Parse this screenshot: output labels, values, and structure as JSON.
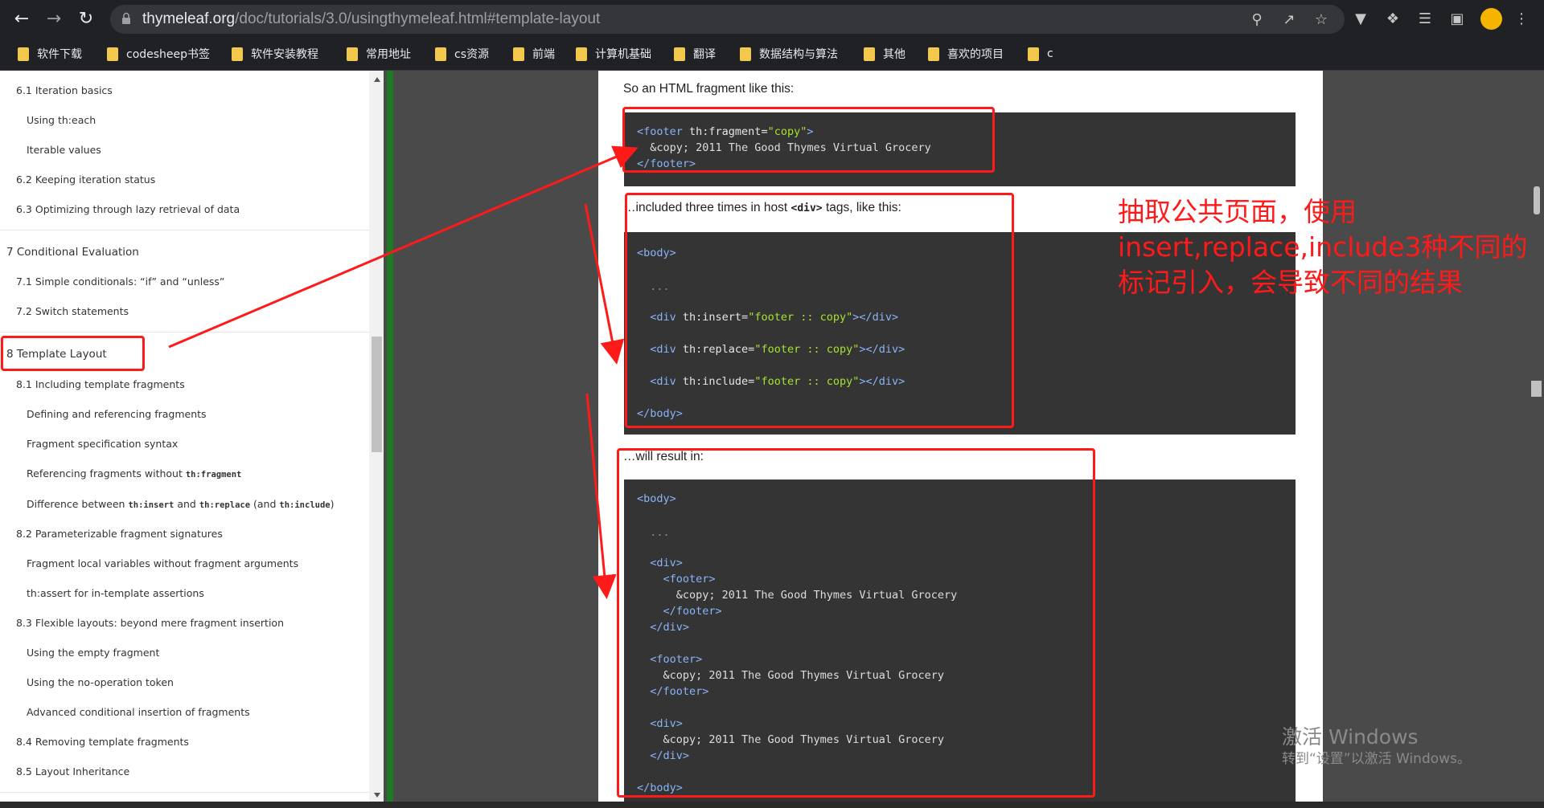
{
  "browser": {
    "url_host": "thymeleaf.org",
    "url_path": "/doc/tutorials/3.0/usingthymeleaf.html#template-layout",
    "bookmarks": [
      "软件下载",
      "codesheep书签",
      "软件安装教程",
      "常用地址",
      "cs资源",
      "前端",
      "计算机基础",
      "翻译",
      "数据结构与算法",
      "其他",
      "喜欢的项目",
      "c"
    ]
  },
  "sidebar": {
    "items": [
      {
        "label": "6.1 Iteration basics"
      },
      {
        "label": "Using th:each"
      },
      {
        "label": "Iterable values"
      },
      {
        "label": "6.2 Keeping iteration status"
      },
      {
        "label": "6.3 Optimizing through lazy retrieval of data"
      },
      {
        "label": "7 Conditional Evaluation"
      },
      {
        "label": "7.1 Simple conditionals: “if” and “unless”"
      },
      {
        "label": "7.2 Switch statements"
      },
      {
        "label": "8 Template Layout"
      },
      {
        "label": "8.1 Including template fragments"
      },
      {
        "label": "Defining and referencing fragments"
      },
      {
        "label": "Fragment specification syntax"
      },
      {
        "label": "Referencing fragments without ",
        "code": "th:fragment"
      },
      {
        "label": "Difference between ",
        "code": "th:insert",
        "label2": " and ",
        "code2": "th:replace",
        "label3": " (and ",
        "code3": "th:include",
        "label4": ")"
      },
      {
        "label": "8.2 Parameterizable fragment signatures"
      },
      {
        "label": "Fragment local variables without fragment arguments"
      },
      {
        "label": "th:assert for in-template assertions"
      },
      {
        "label": "8.3 Flexible layouts: beyond mere fragment insertion"
      },
      {
        "label": "Using the empty fragment"
      },
      {
        "label": "Using the no-operation token"
      },
      {
        "label": "Advanced conditional insertion of fragments"
      },
      {
        "label": "8.4 Removing template fragments"
      },
      {
        "label": "8.5 Layout Inheritance"
      }
    ]
  },
  "content": {
    "p1": "So an HTML fragment like this:",
    "p2_pre": "…included three times in host ",
    "p2_code": "<div>",
    "p2_post": " tags, like this:",
    "p3": "…will result in:",
    "code1": {
      "l1_open": "<footer",
      "l1_attr": " th:fragment=",
      "l1_val": "\"copy\"",
      "l1_close": ">",
      "l2": "  &copy; 2011 The Good Thymes Virtual Grocery",
      "l3": "</footer>"
    },
    "code2": {
      "body_open": "<body>",
      "dots": "  ...",
      "insert_open": "  <div",
      "insert_attr": " th:insert=",
      "insert_val": "\"footer :: copy\"",
      "insert_close": "></div>",
      "replace_open": "  <div",
      "replace_attr": " th:replace=",
      "replace_val": "\"footer :: copy\"",
      "replace_close": "></div>",
      "include_open": "  <div",
      "include_attr": " th:include=",
      "include_val": "\"footer :: copy\"",
      "include_close": "></div>",
      "body_close": "</body>"
    },
    "code3": {
      "body_open": "<body>",
      "dots": "  ...",
      "div1": "  <div>",
      "footer1": "    <footer>",
      "text1": "      &copy; 2011 The Good Thymes Virtual Grocery",
      "footer1_close": "    </footer>",
      "div1_close": "  </div>",
      "footer2": "  <footer>",
      "text2": "    &copy; 2011 The Good Thymes Virtual Grocery",
      "footer2_close": "  </footer>",
      "div3": "  <div>",
      "text3": "    &copy; 2011 The Good Thymes Virtual Grocery",
      "div3_close": "  </div>",
      "body_close": "</body>"
    }
  },
  "annotation": {
    "note": "抽取公共页面，使用insert,replace,include3种不同的标记引入，会导致不同的结果",
    "color": "#ff1a1a"
  },
  "watermark": {
    "line1": "激活 Windows",
    "line2": "转到“设置”以激活 Windows。"
  },
  "colors": {
    "tag": "#8ab4f8",
    "string": "#a6e22e",
    "code_bg": "#343434",
    "sidebar_accent": "#1f7a25"
  }
}
